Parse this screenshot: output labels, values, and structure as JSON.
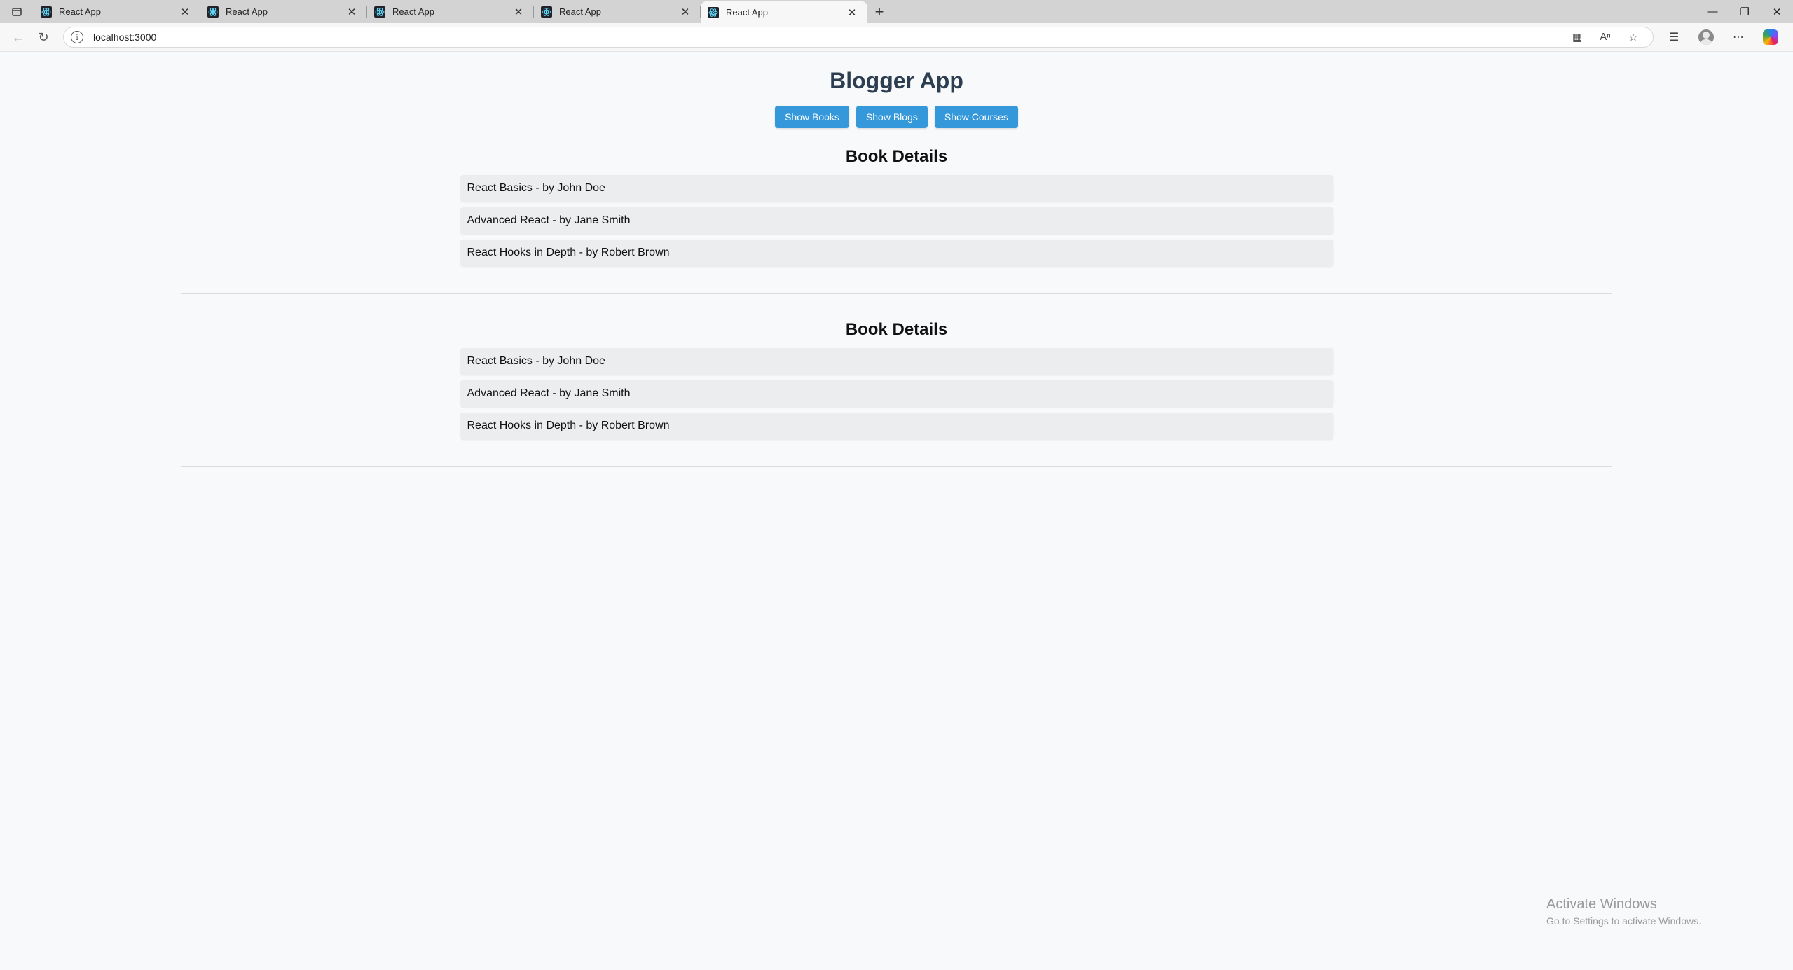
{
  "browser": {
    "tabs": [
      {
        "title": "React App",
        "active": false
      },
      {
        "title": "React App",
        "active": false
      },
      {
        "title": "React App",
        "active": false
      },
      {
        "title": "React App",
        "active": false
      },
      {
        "title": "React App",
        "active": true
      }
    ],
    "url": "localhost:3000"
  },
  "page": {
    "title": "Blogger App",
    "buttons": {
      "books": "Show Books",
      "blogs": "Show Blogs",
      "courses": "Show Courses"
    },
    "sections": [
      {
        "heading": "Book Details",
        "items": [
          "React Basics - by John Doe",
          "Advanced React - by Jane Smith",
          "React Hooks in Depth - by Robert Brown"
        ]
      },
      {
        "heading": "Book Details",
        "items": [
          "React Basics - by John Doe",
          "Advanced React - by Jane Smith",
          "React Hooks in Depth - by Robert Brown"
        ]
      }
    ]
  },
  "watermark": {
    "line1": "Activate Windows",
    "line2": "Go to Settings to activate Windows."
  },
  "colors": {
    "accent": "#3498db",
    "title": "#2c3e50"
  }
}
